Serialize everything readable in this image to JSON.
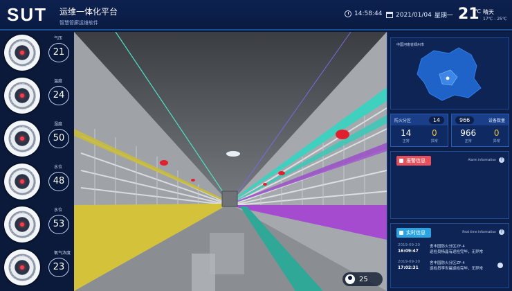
{
  "header": {
    "logo": "SUT",
    "title": "运维一体化平台",
    "subtitle": "智慧管廊运维软件",
    "time": "14:58:44",
    "date": "2021/01/04",
    "weekday": "星期一",
    "temperature": "21",
    "temp_unit": "℃",
    "weather": "晴天",
    "temp_range": "17℃ - 25℃"
  },
  "gauges": [
    {
      "label": "气压",
      "value": "21"
    },
    {
      "label": "温度",
      "value": "24"
    },
    {
      "label": "湿度",
      "value": "50"
    },
    {
      "label": "水位",
      "value": "48"
    },
    {
      "label": "水位",
      "value": "53"
    },
    {
      "label": "氧气浓度",
      "value": "23"
    }
  ],
  "scene": {
    "user_count": "25"
  },
  "right_panel": {
    "map_title": "中国河南省郑州市",
    "partition": {
      "label": "防火分区",
      "total": "14",
      "normal": "14",
      "normal_label": "正常",
      "abnormal": "0",
      "abnormal_label": "异常"
    },
    "devices": {
      "label": "设备数量",
      "total": "966",
      "normal": "966",
      "normal_label": "正常",
      "abnormal": "0",
      "abnormal_label": "异常"
    },
    "alarm": {
      "label": "报警信息",
      "en": "Alarm information",
      "help": "?"
    },
    "realtime": {
      "label": "实时信息",
      "en": "Real time information",
      "help": "?",
      "items": [
        {
          "date": "2019-09-20",
          "time": "16:09:47",
          "line1": "舍丰园防火分区ZF-4",
          "line2": "巡检员杨晶有巡检完毕，无异常"
        },
        {
          "date": "2019-09-20",
          "time": "17:02:31",
          "line1": "舍丰园防火分区ZF-4",
          "line2": "巡检员李世晨巡检完毕，无异常"
        }
      ]
    }
  },
  "colors": {
    "accent": "#1c4f9a",
    "alarm": "#e4505c",
    "realtime": "#29a4e0",
    "warn": "#f0c23a"
  }
}
